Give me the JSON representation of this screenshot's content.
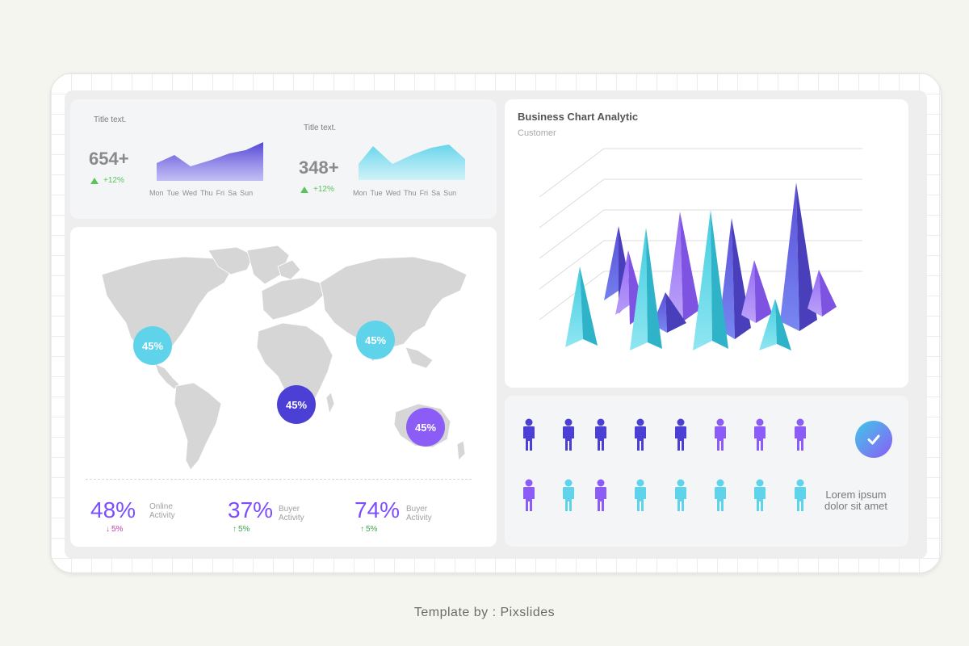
{
  "kpi_cards": [
    {
      "title": "Title text.",
      "value": "654+",
      "change": "+12%",
      "days": [
        "Mon",
        "Tue",
        "Wed",
        "Thu",
        "Fri",
        "Sa",
        "Sun"
      ]
    },
    {
      "title": "Title text.",
      "value": "348+",
      "change": "+12%",
      "days": [
        "Mon",
        "Tue",
        "Wed",
        "Thu",
        "Fri",
        "Sa",
        "Sun"
      ]
    }
  ],
  "map": {
    "bubbles": [
      {
        "label": "45%",
        "color": "#5fd3ea"
      },
      {
        "label": "45%",
        "color": "#5fd3ea"
      },
      {
        "label": "45%",
        "color": "#4c3fd6"
      },
      {
        "label": "45%",
        "color": "#8b5cf6"
      }
    ],
    "stats": [
      {
        "pct": "48%",
        "label_line1": "Online",
        "label_line2": "Activity",
        "change": "5%",
        "arrow": "↓",
        "change_color": "#c23fa8"
      },
      {
        "pct": "37%",
        "label_line1": "Buyer",
        "label_line2": "Activity",
        "change": "5%",
        "arrow": "↑",
        "change_color": "#3fa84f"
      },
      {
        "pct": "74%",
        "label_line1": "Buyer",
        "label_line2": "Activity",
        "change": "5%",
        "arrow": "↑",
        "change_color": "#3fa84f"
      }
    ]
  },
  "chart_card": {
    "title": "Business Chart Analytic",
    "subtitle": "Customer"
  },
  "people_card": {
    "text_line1": "Lorem ipsum",
    "text_line2": "dolor sit amet",
    "check_icon": "check-icon",
    "row1_colors": [
      "#4c3fd6",
      "#4c3fd6",
      "#4c3fd6",
      "#4c3fd6",
      "#4c3fd6",
      "#8b5cf6",
      "#8b5cf6",
      "#8b5cf6"
    ],
    "row2_colors": [
      "#8b5cf6",
      "#5fd3ea",
      "#8b5cf6",
      "#5fd3ea",
      "#5fd3ea",
      "#5fd3ea",
      "#5fd3ea",
      "#5fd3ea"
    ]
  },
  "footer": "Template by : Pixslides",
  "colors": {
    "blue": "#4c3fd6",
    "purple": "#8b5cf6",
    "cyan": "#5fd3ea",
    "green": "#5cc35c"
  }
}
